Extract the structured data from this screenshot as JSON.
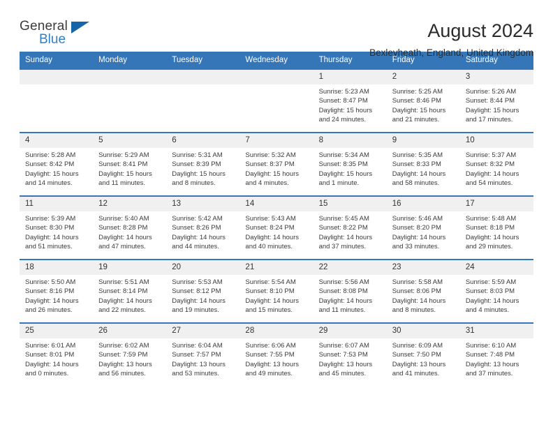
{
  "brand": {
    "name_part1": "General",
    "name_part2": "Blue",
    "triangle_color": "#1565a8",
    "blue_text_color": "#2f7fc6"
  },
  "header": {
    "month_title": "August 2024",
    "location": "Bexleyheath, England, United Kingdom",
    "header_bg_color": "#3476b8",
    "daynum_bg_color": "#f0f0f0"
  },
  "weekday_headers": [
    "Sunday",
    "Monday",
    "Tuesday",
    "Wednesday",
    "Thursday",
    "Friday",
    "Saturday"
  ],
  "weeks": [
    [
      {
        "day": "",
        "blank": true,
        "sunrise": "",
        "sunset": "",
        "daylight_line1": "",
        "daylight_line2": ""
      },
      {
        "day": "",
        "blank": true,
        "sunrise": "",
        "sunset": "",
        "daylight_line1": "",
        "daylight_line2": ""
      },
      {
        "day": "",
        "blank": true,
        "sunrise": "",
        "sunset": "",
        "daylight_line1": "",
        "daylight_line2": ""
      },
      {
        "day": "",
        "blank": true,
        "sunrise": "",
        "sunset": "",
        "daylight_line1": "",
        "daylight_line2": ""
      },
      {
        "day": "1",
        "blank": false,
        "sunrise": "Sunrise: 5:23 AM",
        "sunset": "Sunset: 8:47 PM",
        "daylight_line1": "Daylight: 15 hours",
        "daylight_line2": "and 24 minutes."
      },
      {
        "day": "2",
        "blank": false,
        "sunrise": "Sunrise: 5:25 AM",
        "sunset": "Sunset: 8:46 PM",
        "daylight_line1": "Daylight: 15 hours",
        "daylight_line2": "and 21 minutes."
      },
      {
        "day": "3",
        "blank": false,
        "sunrise": "Sunrise: 5:26 AM",
        "sunset": "Sunset: 8:44 PM",
        "daylight_line1": "Daylight: 15 hours",
        "daylight_line2": "and 17 minutes."
      }
    ],
    [
      {
        "day": "4",
        "blank": false,
        "sunrise": "Sunrise: 5:28 AM",
        "sunset": "Sunset: 8:42 PM",
        "daylight_line1": "Daylight: 15 hours",
        "daylight_line2": "and 14 minutes."
      },
      {
        "day": "5",
        "blank": false,
        "sunrise": "Sunrise: 5:29 AM",
        "sunset": "Sunset: 8:41 PM",
        "daylight_line1": "Daylight: 15 hours",
        "daylight_line2": "and 11 minutes."
      },
      {
        "day": "6",
        "blank": false,
        "sunrise": "Sunrise: 5:31 AM",
        "sunset": "Sunset: 8:39 PM",
        "daylight_line1": "Daylight: 15 hours",
        "daylight_line2": "and 8 minutes."
      },
      {
        "day": "7",
        "blank": false,
        "sunrise": "Sunrise: 5:32 AM",
        "sunset": "Sunset: 8:37 PM",
        "daylight_line1": "Daylight: 15 hours",
        "daylight_line2": "and 4 minutes."
      },
      {
        "day": "8",
        "blank": false,
        "sunrise": "Sunrise: 5:34 AM",
        "sunset": "Sunset: 8:35 PM",
        "daylight_line1": "Daylight: 15 hours",
        "daylight_line2": "and 1 minute."
      },
      {
        "day": "9",
        "blank": false,
        "sunrise": "Sunrise: 5:35 AM",
        "sunset": "Sunset: 8:33 PM",
        "daylight_line1": "Daylight: 14 hours",
        "daylight_line2": "and 58 minutes."
      },
      {
        "day": "10",
        "blank": false,
        "sunrise": "Sunrise: 5:37 AM",
        "sunset": "Sunset: 8:32 PM",
        "daylight_line1": "Daylight: 14 hours",
        "daylight_line2": "and 54 minutes."
      }
    ],
    [
      {
        "day": "11",
        "blank": false,
        "sunrise": "Sunrise: 5:39 AM",
        "sunset": "Sunset: 8:30 PM",
        "daylight_line1": "Daylight: 14 hours",
        "daylight_line2": "and 51 minutes."
      },
      {
        "day": "12",
        "blank": false,
        "sunrise": "Sunrise: 5:40 AM",
        "sunset": "Sunset: 8:28 PM",
        "daylight_line1": "Daylight: 14 hours",
        "daylight_line2": "and 47 minutes."
      },
      {
        "day": "13",
        "blank": false,
        "sunrise": "Sunrise: 5:42 AM",
        "sunset": "Sunset: 8:26 PM",
        "daylight_line1": "Daylight: 14 hours",
        "daylight_line2": "and 44 minutes."
      },
      {
        "day": "14",
        "blank": false,
        "sunrise": "Sunrise: 5:43 AM",
        "sunset": "Sunset: 8:24 PM",
        "daylight_line1": "Daylight: 14 hours",
        "daylight_line2": "and 40 minutes."
      },
      {
        "day": "15",
        "blank": false,
        "sunrise": "Sunrise: 5:45 AM",
        "sunset": "Sunset: 8:22 PM",
        "daylight_line1": "Daylight: 14 hours",
        "daylight_line2": "and 37 minutes."
      },
      {
        "day": "16",
        "blank": false,
        "sunrise": "Sunrise: 5:46 AM",
        "sunset": "Sunset: 8:20 PM",
        "daylight_line1": "Daylight: 14 hours",
        "daylight_line2": "and 33 minutes."
      },
      {
        "day": "17",
        "blank": false,
        "sunrise": "Sunrise: 5:48 AM",
        "sunset": "Sunset: 8:18 PM",
        "daylight_line1": "Daylight: 14 hours",
        "daylight_line2": "and 29 minutes."
      }
    ],
    [
      {
        "day": "18",
        "blank": false,
        "sunrise": "Sunrise: 5:50 AM",
        "sunset": "Sunset: 8:16 PM",
        "daylight_line1": "Daylight: 14 hours",
        "daylight_line2": "and 26 minutes."
      },
      {
        "day": "19",
        "blank": false,
        "sunrise": "Sunrise: 5:51 AM",
        "sunset": "Sunset: 8:14 PM",
        "daylight_line1": "Daylight: 14 hours",
        "daylight_line2": "and 22 minutes."
      },
      {
        "day": "20",
        "blank": false,
        "sunrise": "Sunrise: 5:53 AM",
        "sunset": "Sunset: 8:12 PM",
        "daylight_line1": "Daylight: 14 hours",
        "daylight_line2": "and 19 minutes."
      },
      {
        "day": "21",
        "blank": false,
        "sunrise": "Sunrise: 5:54 AM",
        "sunset": "Sunset: 8:10 PM",
        "daylight_line1": "Daylight: 14 hours",
        "daylight_line2": "and 15 minutes."
      },
      {
        "day": "22",
        "blank": false,
        "sunrise": "Sunrise: 5:56 AM",
        "sunset": "Sunset: 8:08 PM",
        "daylight_line1": "Daylight: 14 hours",
        "daylight_line2": "and 11 minutes."
      },
      {
        "day": "23",
        "blank": false,
        "sunrise": "Sunrise: 5:58 AM",
        "sunset": "Sunset: 8:06 PM",
        "daylight_line1": "Daylight: 14 hours",
        "daylight_line2": "and 8 minutes."
      },
      {
        "day": "24",
        "blank": false,
        "sunrise": "Sunrise: 5:59 AM",
        "sunset": "Sunset: 8:03 PM",
        "daylight_line1": "Daylight: 14 hours",
        "daylight_line2": "and 4 minutes."
      }
    ],
    [
      {
        "day": "25",
        "blank": false,
        "sunrise": "Sunrise: 6:01 AM",
        "sunset": "Sunset: 8:01 PM",
        "daylight_line1": "Daylight: 14 hours",
        "daylight_line2": "and 0 minutes."
      },
      {
        "day": "26",
        "blank": false,
        "sunrise": "Sunrise: 6:02 AM",
        "sunset": "Sunset: 7:59 PM",
        "daylight_line1": "Daylight: 13 hours",
        "daylight_line2": "and 56 minutes."
      },
      {
        "day": "27",
        "blank": false,
        "sunrise": "Sunrise: 6:04 AM",
        "sunset": "Sunset: 7:57 PM",
        "daylight_line1": "Daylight: 13 hours",
        "daylight_line2": "and 53 minutes."
      },
      {
        "day": "28",
        "blank": false,
        "sunrise": "Sunrise: 6:06 AM",
        "sunset": "Sunset: 7:55 PM",
        "daylight_line1": "Daylight: 13 hours",
        "daylight_line2": "and 49 minutes."
      },
      {
        "day": "29",
        "blank": false,
        "sunrise": "Sunrise: 6:07 AM",
        "sunset": "Sunset: 7:53 PM",
        "daylight_line1": "Daylight: 13 hours",
        "daylight_line2": "and 45 minutes."
      },
      {
        "day": "30",
        "blank": false,
        "sunrise": "Sunrise: 6:09 AM",
        "sunset": "Sunset: 7:50 PM",
        "daylight_line1": "Daylight: 13 hours",
        "daylight_line2": "and 41 minutes."
      },
      {
        "day": "31",
        "blank": false,
        "sunrise": "Sunrise: 6:10 AM",
        "sunset": "Sunset: 7:48 PM",
        "daylight_line1": "Daylight: 13 hours",
        "daylight_line2": "and 37 minutes."
      }
    ]
  ]
}
